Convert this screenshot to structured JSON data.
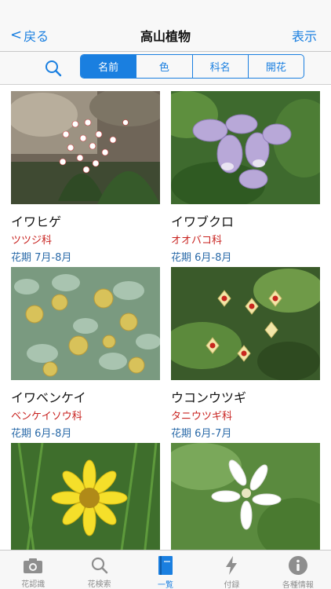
{
  "nav": {
    "back_label": "戻る",
    "title": "高山植物",
    "right_label": "表示"
  },
  "toolbar": {
    "segments": [
      "名前",
      "色",
      "科名",
      "開花"
    ],
    "selected": "名前"
  },
  "plants": [
    {
      "name": "イワヒゲ",
      "family": "ツツジ科",
      "bloom": "花期 7月-8月"
    },
    {
      "name": "イワブクロ",
      "family": "オオバコ科",
      "bloom": "花期 6月-8月"
    },
    {
      "name": "イワベンケイ",
      "family": "ベンケイソウ科",
      "bloom": "花期 6月-8月"
    },
    {
      "name": "ウコンウツギ",
      "family": "タニウツギ科",
      "bloom": "花期 6月-7月"
    }
  ],
  "tabs": [
    {
      "label": "花認識",
      "icon": "camera-icon"
    },
    {
      "label": "花検索",
      "icon": "search-icon"
    },
    {
      "label": "一覧",
      "icon": "book-icon"
    },
    {
      "label": "付録",
      "icon": "lightning-icon"
    },
    {
      "label": "各種情報",
      "icon": "info-icon"
    }
  ],
  "active_tab": "一覧",
  "colors": {
    "accent": "#1a7fe0",
    "family_text": "#c8221f",
    "bloom_text": "#2a6aa8"
  }
}
